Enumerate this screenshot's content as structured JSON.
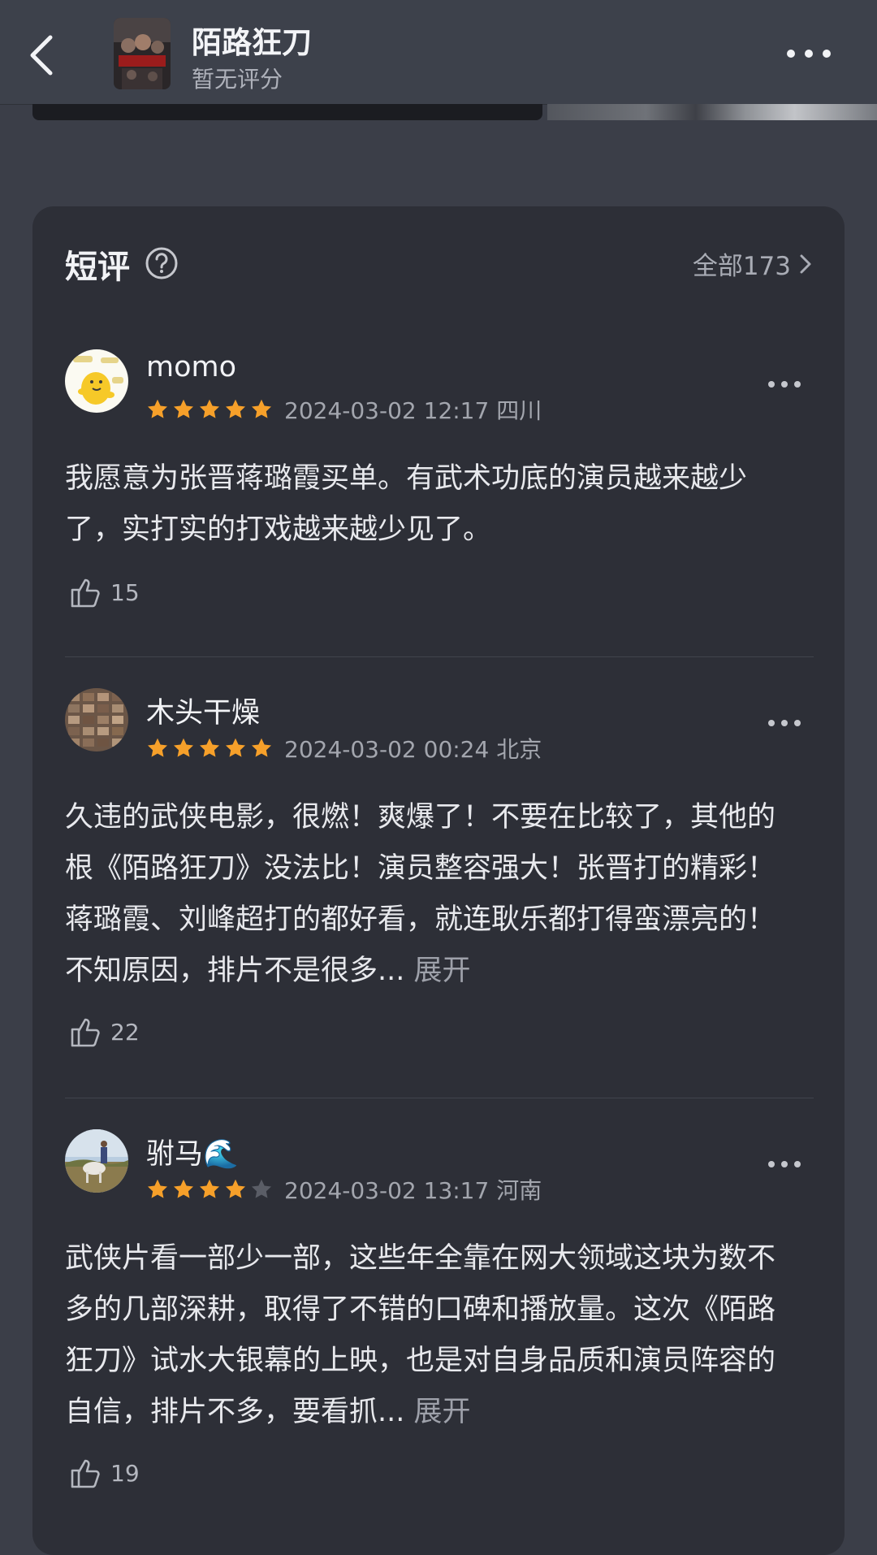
{
  "header": {
    "title": "陌路狂刀",
    "subtitle": "暂无评分"
  },
  "section": {
    "title": "短评",
    "all_label": "全部173"
  },
  "reviews": [
    {
      "username": "momo",
      "rating": 5,
      "meta": "2024-03-02 12:17 四川",
      "text": "我愿意为张晋蒋璐霞买单。有武术功底的演员越来越少了，实打实的打戏越来越少见了。",
      "expand": "",
      "likes": "15"
    },
    {
      "username": "木头干燥",
      "rating": 5,
      "meta": "2024-03-02 00:24 北京",
      "text": "久违的武侠电影，很燃！爽爆了！不要在比较了，其他的根《陌路狂刀》没法比！演员整容强大！张晋打的精彩！蒋璐霞、刘峰超打的都好看，就连耿乐都打得蛮漂亮的！不知原因，排片不是很多... ",
      "expand": "展开",
      "likes": "22"
    },
    {
      "username": "驸马🌊",
      "rating": 4,
      "meta": "2024-03-02 13:17 河南",
      "text": "武侠片看一部少一部，这些年全靠在网大领域这块为数不多的几部深耕，取得了不错的口碑和播放量。这次《陌路狂刀》试水大银幕的上映，也是对自身品质和演员阵容的自信，排片不多，要看抓... ",
      "expand": "展开",
      "likes": "19"
    }
  ],
  "colors": {
    "star_on": "#f6a02a",
    "star_off": "#5a5d66",
    "card_bg": "#2d2f37",
    "page_bg": "#3b3e48"
  }
}
